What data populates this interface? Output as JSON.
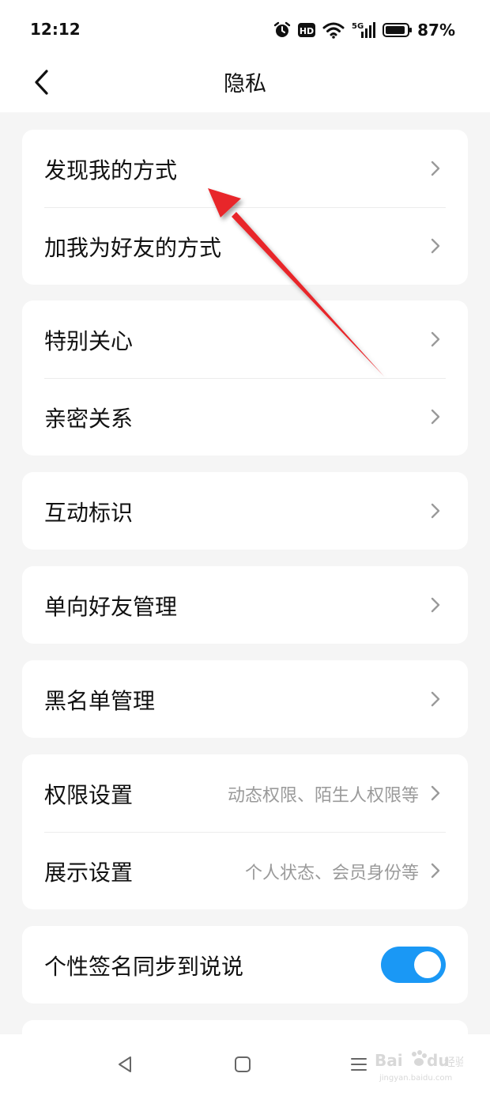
{
  "status_bar": {
    "time": "12:12",
    "hd_badge": "HD",
    "network": "5G",
    "battery": "87%",
    "icons": [
      "alarm-icon",
      "hd-icon",
      "wifi-icon",
      "signal-5g-icon",
      "battery-icon"
    ]
  },
  "header": {
    "title": "隐私",
    "back_icon": "chevron-left-icon"
  },
  "groups": [
    {
      "rows": [
        {
          "label": "发现我的方式"
        },
        {
          "label": "加我为好友的方式"
        }
      ]
    },
    {
      "rows": [
        {
          "label": "特别关心"
        },
        {
          "label": "亲密关系"
        }
      ]
    },
    {
      "rows": [
        {
          "label": "互动标识"
        }
      ]
    },
    {
      "rows": [
        {
          "label": "单向好友管理"
        }
      ]
    },
    {
      "rows": [
        {
          "label": "黑名单管理"
        }
      ]
    },
    {
      "rows": [
        {
          "label": "权限设置",
          "value": "动态权限、陌生人权限等"
        },
        {
          "label": "展示设置",
          "value": "个人状态、会员身份等"
        }
      ]
    },
    {
      "rows": [
        {
          "label": "个性签名同步到说说",
          "toggle": true
        }
      ]
    }
  ],
  "system_nav": {
    "icons": [
      "back-triangle-icon",
      "home-square-icon",
      "menu-lines-icon"
    ]
  },
  "watermark": {
    "brand": "Bai",
    "brand_suffix": "du",
    "cn": "经验",
    "url": "jingyan.baidu.com"
  },
  "colors": {
    "accent": "#1a98f5",
    "background": "#f5f5f5",
    "card": "#ffffff",
    "annotation_arrow": "#e8262b"
  }
}
